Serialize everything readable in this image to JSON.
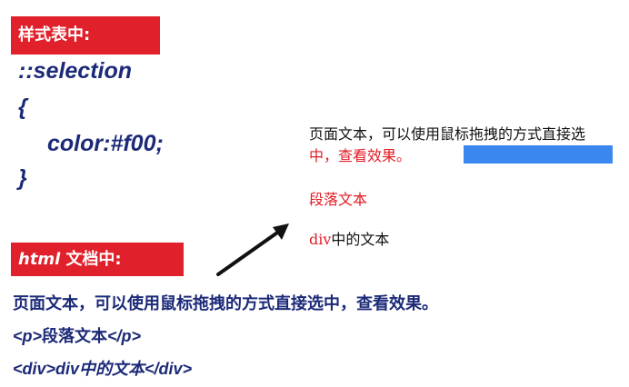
{
  "css_section": {
    "label": "样式表中:",
    "code_lines": [
      "::selection",
      "{",
      "color:#f00;",
      "}"
    ]
  },
  "html_section": {
    "label_em": "html",
    "label_rest": "文档中:",
    "line1": "页面文本，可以使用鼠标拖拽的方式直接选中，查看效果。",
    "line2_open": "<p>",
    "line2_text": "段落文本",
    "line2_close": "</p>",
    "line3_open": "<div>",
    "line3_text": "div中的文本",
    "line3_close": "</div>"
  },
  "demo": {
    "para_part1": "页面文本，可以使用鼠标拖拽的方式直接选",
    "para_selected": "中，查看效果。",
    "p_text": "段落文本",
    "div_prefix": "div",
    "div_rest": "中的文本"
  },
  "colors": {
    "badge_bg": "#e0202a",
    "code_text": "#1c2a78",
    "selection_text": "#e31b23",
    "selection_bg": "#3a88ef"
  }
}
